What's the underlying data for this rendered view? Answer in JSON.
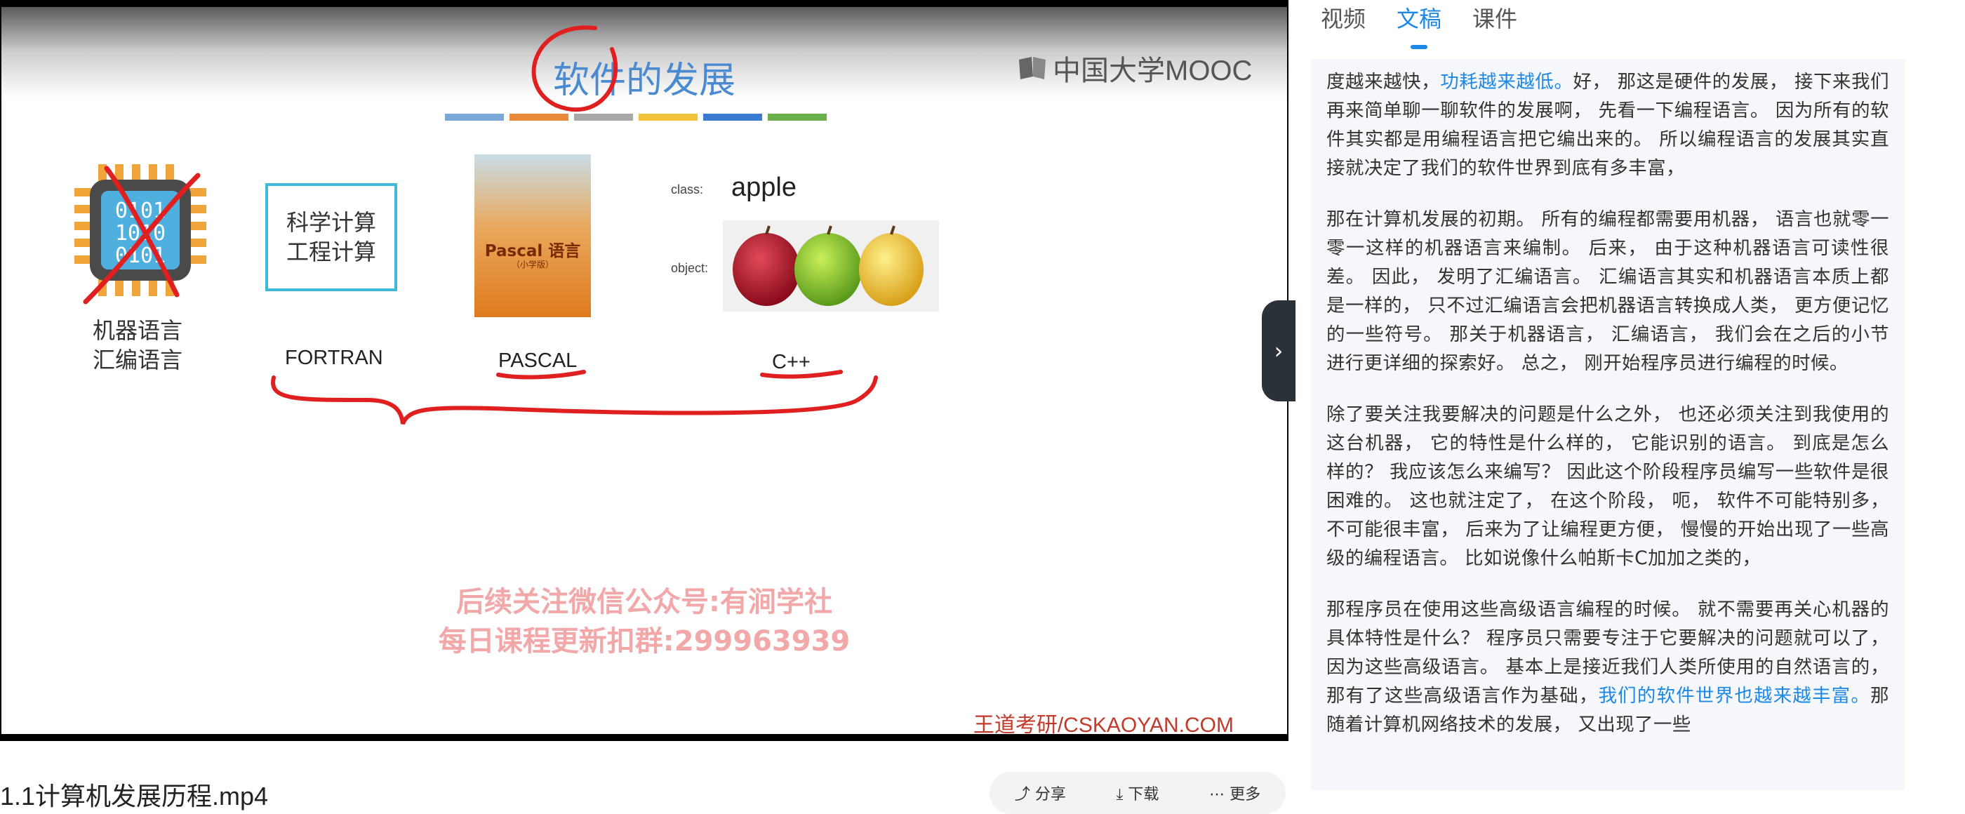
{
  "slide": {
    "title": "软件的发展",
    "logo_text": "中国大学MOOC",
    "strip_colors": [
      "#7aa8d8",
      "#e88a3a",
      "#a8a8a8",
      "#f0c23a",
      "#3a7ad0",
      "#6ab04a"
    ],
    "machine_label_1": "机器语言",
    "machine_label_2": "汇编语言",
    "chip_bits": "0101\n1010\n0101",
    "sci_line_1": "科学计算",
    "sci_line_2": "工程计算",
    "book_title": "Pascal 语言",
    "book_subtitle": "（小学版）",
    "fortran_label": "FORTRAN",
    "pascal_label": "PASCAL",
    "cpp_label": "C++",
    "class_label": "class:",
    "class_value": "apple",
    "object_label": "object:",
    "watermark_line_1": "后续关注微信公众号:有涧学社",
    "watermark_line_2": "每日课程更新扣群:299963939",
    "source_credit": "王道考研/CSKAOYAN.COM"
  },
  "player": {
    "collapse_icon": "chevron-right-icon",
    "collapse_glyph": "›"
  },
  "video_title": "1.1计算机发展历程.mp4",
  "actions": {
    "share": "分享",
    "download": "下载",
    "more": "更多"
  },
  "panel": {
    "tabs": [
      {
        "label": "视频",
        "active": false
      },
      {
        "label": "文稿",
        "active": true
      },
      {
        "label": "课件",
        "active": false
      }
    ],
    "accent_color": "#1e88e5"
  },
  "transcript": {
    "p1_a": "度越来越快，",
    "p1_hl": "功耗越来越低。",
    "p1_b": "好， 那这是硬件的发展， 接下来我们再来简单聊一聊软件的发展啊， 先看一下编程语言。 因为所有的软件其实都是用编程语言把它编出来的。 所以编程语言的发展其实直接就决定了我们的软件世界到底有多丰富，",
    "p2": "那在计算机发展的初期。 所有的编程都需要用机器， 语言也就零一零一这样的机器语言来编制。 后来， 由于这种机器语言可读性很差。 因此， 发明了汇编语言。 汇编语言其实和机器语言本质上都是一样的， 只不过汇编语言会把机器语言转换成人类， 更方便记忆的一些符号。 那关于机器语言， 汇编语言， 我们会在之后的小节进行更详细的探索好。 总之， 刚开始程序员进行编程的时候。",
    "p3": "除了要关注我要解决的问题是什么之外， 也还必须关注到我使用的这台机器， 它的特性是什么样的， 它能识别的语言。 到底是怎么样的？ 我应该怎么来编写？ 因此这个阶段程序员编写一些软件是很困难的。 这也就注定了， 在这个阶段， 呃， 软件不可能特别多， 不可能很丰富， 后来为了让编程更方便， 慢慢的开始出现了一些高级的编程语言。 比如说像什么帕斯卡C加加之类的，",
    "p4_a": "那程序员在使用这些高级语言编程的时候。 就不需要再关心机器的具体特性是什么？ 程序员只需要专注于它要解决的问题就可以了， 因为这些高级语言。 基本上是接近我们人类所使用的自然语言的， 那有了这些高级语言作为基础，",
    "p4_hl": "我们的软件世界也越来越丰富。",
    "p4_b": "那随着计算机网络技术的发展， 又出现了一些"
  }
}
